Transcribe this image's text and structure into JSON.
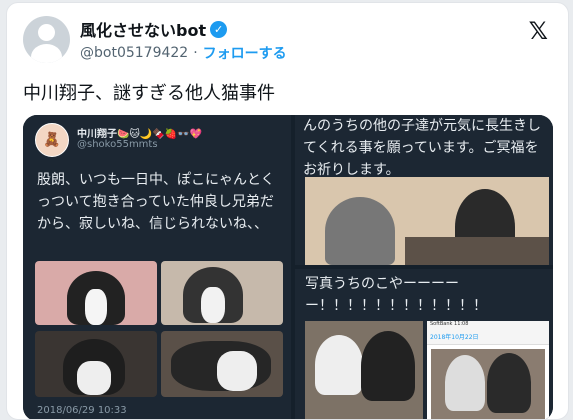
{
  "tweet": {
    "display_name": "風化させないbot",
    "handle": "@bot05179422",
    "separator": "·",
    "follow_label": "フォローする",
    "text": "中川翔子、謎すぎる他人猫事件",
    "x_logo": "𝕏"
  },
  "media": {
    "left_panel": {
      "name": "中川翔子🍉🐱🌙🍫🍓👓💖",
      "handle": "@shoko55mmts",
      "text": "股朗、いつも一日中、ぽこにゃんとくっついて抱き合っていた仲良し兄弟だから、寂しいね、信じられないね、、",
      "date": "2018/06/29 10:33"
    },
    "top_right_panel": {
      "text": "んのうちの他の子達が元気に長生きしてくれる事を願っています。ご冥福をお祈りします。"
    },
    "bottom_right_panel": {
      "text": "写真うちのこやーーーーー！！！！！！！！！！！！",
      "phone_status": "SoftBank 11:08",
      "phone_nav": "2018年10月22日"
    }
  },
  "colors": {
    "verified": "#1d9bf0",
    "follow": "#1d9bf0",
    "media_bg": "#15202b"
  }
}
